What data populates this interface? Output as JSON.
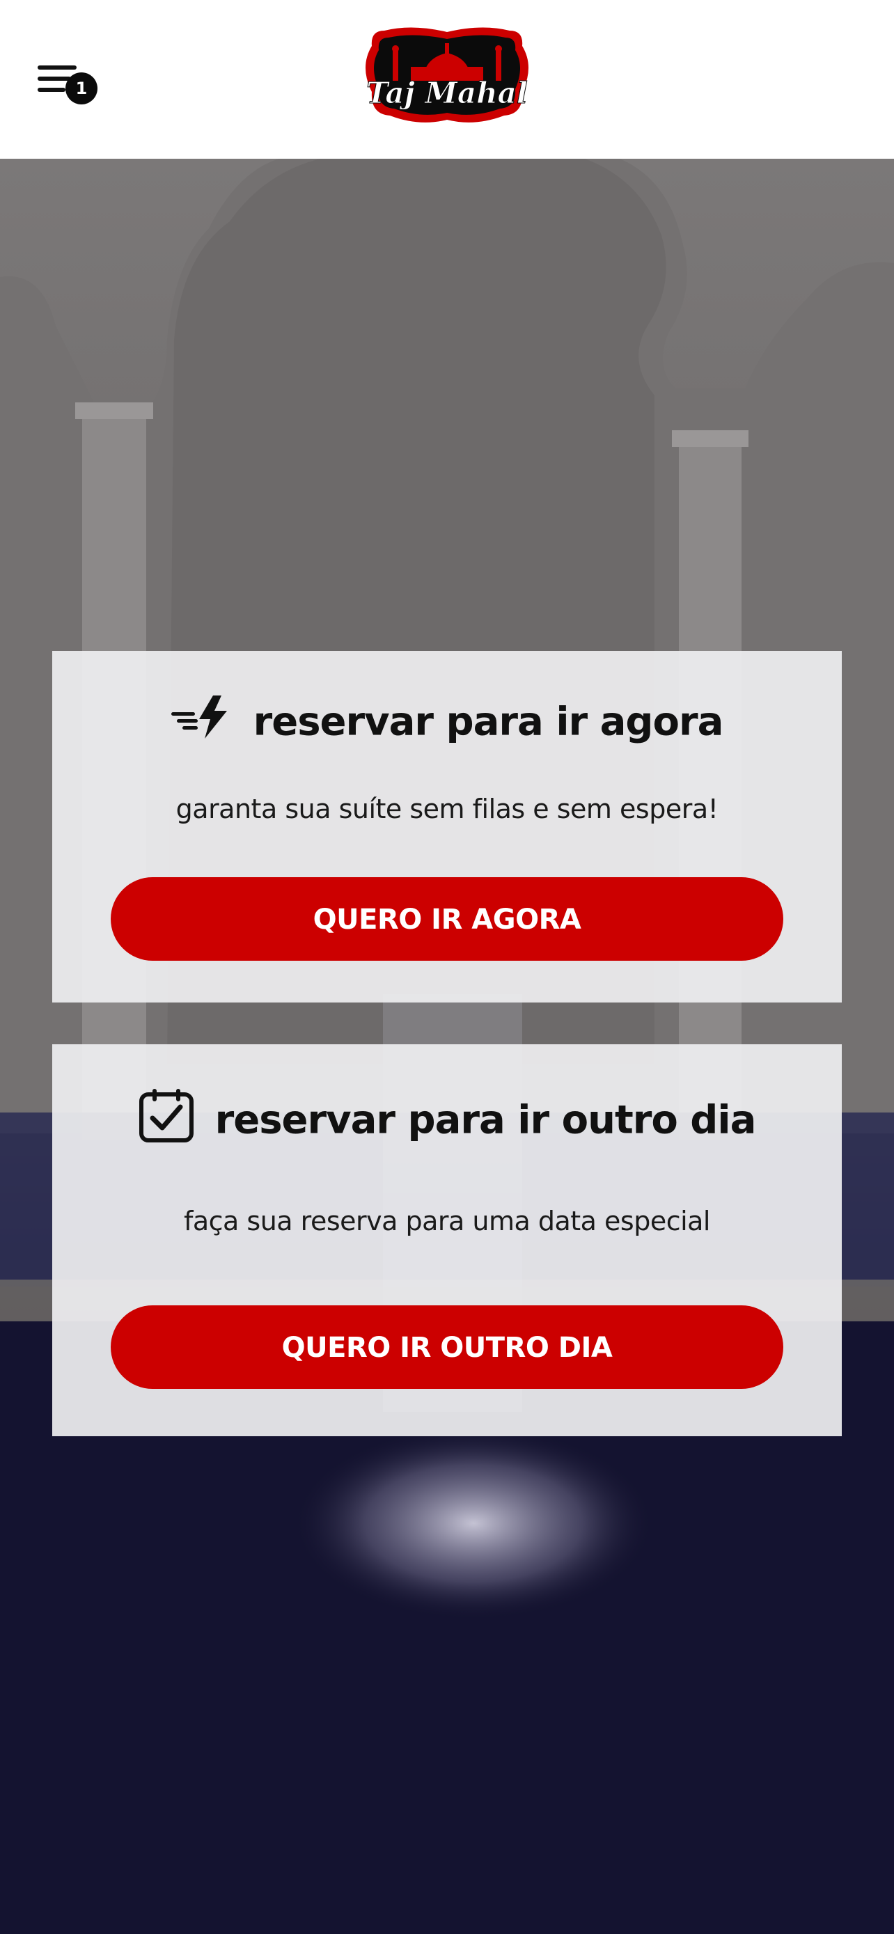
{
  "header": {
    "menu_icon": "menu-icon",
    "cart_count": "1",
    "logo": {
      "text": "Taj Mahal",
      "colors": {
        "primary": "#cc0000",
        "dark": "#0b0b0b"
      }
    }
  },
  "cards": [
    {
      "icon": "lightning-speed-icon",
      "title": "reservar para ir agora",
      "subtitle": "garanta sua suíte sem filas e sem espera!",
      "button_label": "QUERO IR AGORA"
    },
    {
      "icon": "calendar-check-icon",
      "title": "reservar para ir outro dia",
      "subtitle": "faça sua reserva para uma data especial",
      "button_label": "QUERO IR OUTRO DIA"
    }
  ],
  "colors": {
    "accent": "#cc0000",
    "card_bg": "#eeeef0",
    "text": "#111111"
  }
}
